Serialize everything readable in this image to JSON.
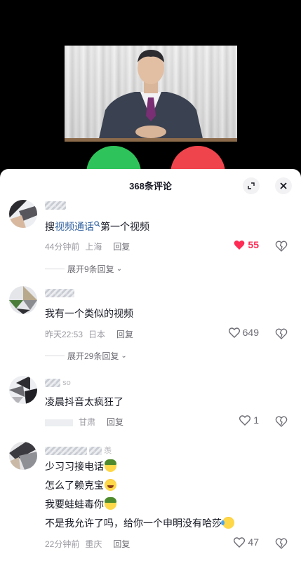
{
  "header": {
    "title": "368条评论"
  },
  "comments": [
    {
      "text_plain": "搜",
      "text_link": "视频通话",
      "text_after": "第一个视频",
      "time": "44分钟前",
      "location": "上海",
      "reply": "回复",
      "likes": "55",
      "liked": true,
      "expand": "展开9条回复"
    },
    {
      "text": "我有一个类似的视频",
      "time": "昨天22:53",
      "location": "日本",
      "reply": "回复",
      "likes": "649",
      "liked": false,
      "expand": "展开29条回复"
    },
    {
      "username": "so",
      "text": "凌晨抖音太疯狂了",
      "location": "甘肃",
      "reply": "回复",
      "likes": "1",
      "liked": false
    },
    {
      "username": "羡",
      "lines": [
        "少习习接电话",
        "怎么了赖克宝",
        "我要蛙蛙毒你",
        "不是我允许了吗，给你一个申明没有哈莎"
      ],
      "time": "22分钟前",
      "location": "重庆",
      "reply": "回复",
      "likes": "47",
      "liked": false
    }
  ],
  "colors": {
    "accent_like": "#fe2c55",
    "link": "#32629f",
    "answer": "#2fc45b",
    "decline": "#f0444d"
  },
  "icons": [
    "expand-icon",
    "close-icon",
    "search-icon",
    "heart-icon",
    "dislike-icon",
    "chevron-down-icon"
  ]
}
